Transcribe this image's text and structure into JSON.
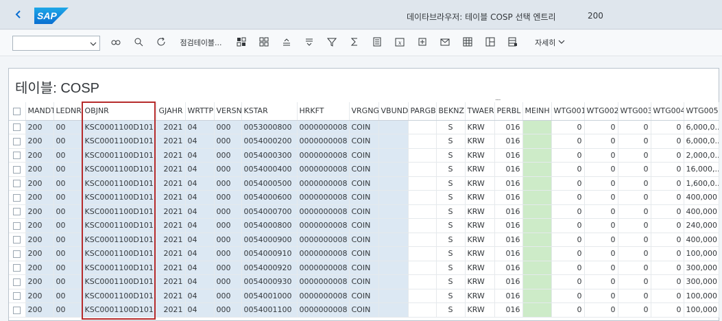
{
  "shell": {
    "back_icon": "chevron-left-icon",
    "logo_text": "SAP",
    "title": "데이타브라우저: 테이블 COSP 선택 엔트리",
    "count": "200"
  },
  "toolbar": {
    "dropdown_value": "",
    "check_table_label": "점검테이블...",
    "details_label": "자세히"
  },
  "panel": {
    "title": "테이블: COSP",
    "grip": "...."
  },
  "columns": [
    "MANDT",
    "LEDNR",
    "OBJNR",
    "GJAHR",
    "WRTTP",
    "VERSN",
    "KSTAR",
    "HRKFT",
    "VRGNG",
    "VBUND",
    "PARGB",
    "BEKNZ",
    "TWAER",
    "PERBL",
    "MEINH",
    "WTG001",
    "WTG002",
    "WTG003",
    "WTG004",
    "WTG005"
  ],
  "rows": [
    [
      "200",
      "00",
      "KSC0001100D101",
      "2021",
      "04",
      "000",
      "0053000800",
      "0000000008",
      "COIN",
      "",
      "",
      "S",
      "KRW",
      "016",
      "",
      "0",
      "0",
      "0",
      "0",
      "6,000,0..."
    ],
    [
      "200",
      "00",
      "KSC0001100D101",
      "2021",
      "04",
      "000",
      "0054000200",
      "0000000008",
      "COIN",
      "",
      "",
      "S",
      "KRW",
      "016",
      "",
      "0",
      "0",
      "0",
      "0",
      "6,000,0..."
    ],
    [
      "200",
      "00",
      "KSC0001100D101",
      "2021",
      "04",
      "000",
      "0054000300",
      "0000000008",
      "COIN",
      "",
      "",
      "S",
      "KRW",
      "016",
      "",
      "0",
      "0",
      "0",
      "0",
      "2,000,0..."
    ],
    [
      "200",
      "00",
      "KSC0001100D101",
      "2021",
      "04",
      "000",
      "0054000400",
      "0000000008",
      "COIN",
      "",
      "",
      "S",
      "KRW",
      "016",
      "",
      "0",
      "0",
      "0",
      "0",
      "16,000,..."
    ],
    [
      "200",
      "00",
      "KSC0001100D101",
      "2021",
      "04",
      "000",
      "0054000500",
      "0000000008",
      "COIN",
      "",
      "",
      "S",
      "KRW",
      "016",
      "",
      "0",
      "0",
      "0",
      "0",
      "1,600,0..."
    ],
    [
      "200",
      "00",
      "KSC0001100D101",
      "2021",
      "04",
      "000",
      "0054000600",
      "0000000008",
      "COIN",
      "",
      "",
      "S",
      "KRW",
      "016",
      "",
      "0",
      "0",
      "0",
      "0",
      "400,000"
    ],
    [
      "200",
      "00",
      "KSC0001100D101",
      "2021",
      "04",
      "000",
      "0054000700",
      "0000000008",
      "COIN",
      "",
      "",
      "S",
      "KRW",
      "016",
      "",
      "0",
      "0",
      "0",
      "0",
      "400,000"
    ],
    [
      "200",
      "00",
      "KSC0001100D101",
      "2021",
      "04",
      "000",
      "0054000800",
      "0000000008",
      "COIN",
      "",
      "",
      "S",
      "KRW",
      "016",
      "",
      "0",
      "0",
      "0",
      "0",
      "240,000"
    ],
    [
      "200",
      "00",
      "KSC0001100D101",
      "2021",
      "04",
      "000",
      "0054000900",
      "0000000008",
      "COIN",
      "",
      "",
      "S",
      "KRW",
      "016",
      "",
      "0",
      "0",
      "0",
      "0",
      "400,000"
    ],
    [
      "200",
      "00",
      "KSC0001100D101",
      "2021",
      "04",
      "000",
      "0054000910",
      "0000000008",
      "COIN",
      "",
      "",
      "S",
      "KRW",
      "016",
      "",
      "0",
      "0",
      "0",
      "0",
      "100,000"
    ],
    [
      "200",
      "00",
      "KSC0001100D101",
      "2021",
      "04",
      "000",
      "0054000920",
      "0000000008",
      "COIN",
      "",
      "",
      "S",
      "KRW",
      "016",
      "",
      "0",
      "0",
      "0",
      "0",
      "300,000"
    ],
    [
      "200",
      "00",
      "KSC0001100D101",
      "2021",
      "04",
      "000",
      "0054000930",
      "0000000008",
      "COIN",
      "",
      "",
      "S",
      "KRW",
      "016",
      "",
      "0",
      "0",
      "0",
      "0",
      "300,000"
    ],
    [
      "200",
      "00",
      "KSC0001100D101",
      "2021",
      "04",
      "000",
      "0054001000",
      "0000000008",
      "COIN",
      "",
      "",
      "S",
      "KRW",
      "016",
      "",
      "0",
      "0",
      "0",
      "0",
      "100,000"
    ],
    [
      "200",
      "00",
      "KSC0001100D101",
      "2021",
      "04",
      "000",
      "0054001100",
      "0000000008",
      "COIN",
      "",
      "",
      "S",
      "KRW",
      "016",
      "",
      "0",
      "0",
      "0",
      "0",
      "100,000"
    ]
  ],
  "colors": {
    "shell_bg": "#dfe6ed",
    "key_column_bg": "#dce8f3",
    "meinh_bg": "#cdebc8",
    "highlight_border": "#b52a2a",
    "back_icon": "#0a6ed1",
    "logo": "#0a6ed1"
  }
}
